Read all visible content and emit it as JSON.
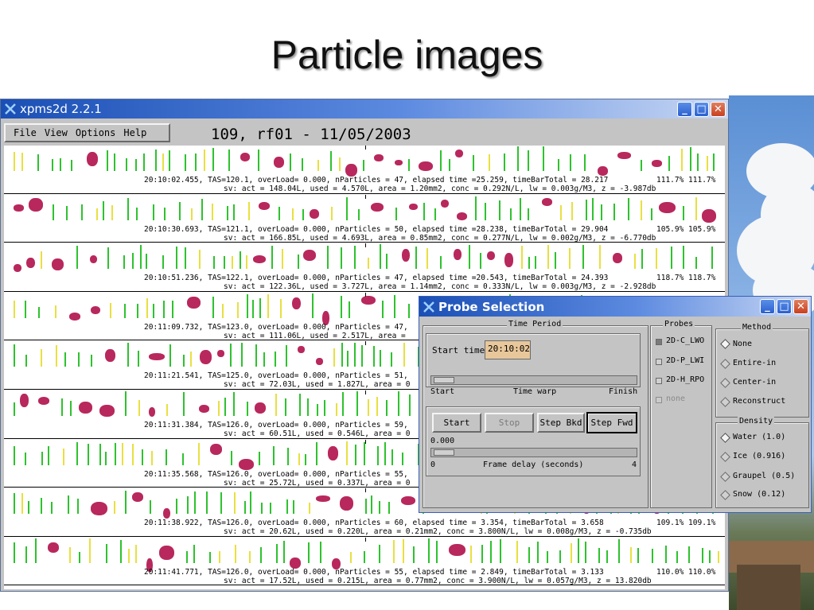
{
  "slide": {
    "title": "Particle images"
  },
  "window": {
    "title": "xpms2d 2.2.1",
    "menu": [
      "File",
      "View",
      "Options",
      "Help"
    ],
    "headline": "109, rf01 - 11/05/2003",
    "controls": {
      "minimize": "_",
      "maximize": "□",
      "close": "✕"
    }
  },
  "strips": [
    {
      "line1": "20:10:02.455, TAS=120.1, overLoad= 0.000, nParticles = 47, elapsed time =25.259, timeBarTotal = 28.217",
      "line1_right": "111.7% 111.7%",
      "line2": "sv: act = 148.04L, used = 4.570L, area = 1.20mm2, conc = 0.292N/L, lw = 0.003g/M3, z = -3.987db"
    },
    {
      "line1": "20:10:30.693, TAS=121.1, overLoad= 0.000, nParticles = 50, elapsed time =28.238, timeBarTotal = 29.904",
      "line1_right": "105.9% 105.9%",
      "line2": "sv: act = 166.85L, used = 4.693L, area = 0.85mm2, conc = 0.277N/L, lw = 0.002g/M3, z = -6.770db"
    },
    {
      "line1": "20:10:51.236, TAS=122.1, overLoad= 0.000, nParticles = 47, elapsed time =20.543, timeBarTotal = 24.393",
      "line1_right": "118.7% 118.7%",
      "line2": "sv: act = 122.36L, used = 3.727L, area = 1.14mm2, conc = 0.333N/L, lw = 0.003g/M3, z = -2.928db"
    },
    {
      "line1": "20:11:09.732, TAS=123.0, overLoad= 0.000, nParticles = 47,",
      "line1_right": "",
      "line2": "sv: act = 111.06L, used = 2.517L, area ="
    },
    {
      "line1": "20:11:21.541, TAS=125.0, overLoad= 0.000, nParticles = 51,",
      "line1_right": "",
      "line2": "sv: act = 72.03L, used = 1.827L, area = 0"
    },
    {
      "line1": "20:11:31.384, TAS=126.0, overLoad= 0.000, nParticles = 59,",
      "line1_right": "",
      "line2": "sv: act = 60.51L, used = 0.546L, area = 0"
    },
    {
      "line1": "20:11:35.568, TAS=126.0, overLoad= 0.000, nParticles = 55,",
      "line1_right": "",
      "line2": "sv: act = 25.72L, used = 0.337L, area = 0"
    },
    {
      "line1": "20:11:38.922, TAS=126.0, overLoad= 0.000, nParticles = 60, elapsed time = 3.354, timeBarTotal = 3.658",
      "line1_right": "109.1% 109.1%",
      "line2": "sv: act = 20.62L, used = 0.220L, area = 0.21mm2, conc = 3.800N/L, lw = 0.008g/M3, z = -0.735db"
    },
    {
      "line1": "20:11:41.771, TAS=126.0, overLoad= 0.000, nParticles = 55, elapsed time = 2.849, timeBarTotal = 3.133",
      "line1_right": "110.0% 110.0%",
      "line2": "sv: act = 17.52L, used = 0.215L, area = 0.77mm2, conc = 3.900N/L, lw = 0.057g/M3, z = 13.820db"
    }
  ],
  "dialog": {
    "title": "Probe Selection",
    "time_period": {
      "label": "Time Period",
      "start_time_label": "Start time",
      "start_time_value": "20:10:02",
      "slider_start": "Start",
      "slider_mid": "Time warp",
      "slider_end": "Finish"
    },
    "playback": {
      "buttons": [
        "Start",
        "Stop",
        "Step Bkd",
        "Step Fwd"
      ],
      "delay_value": "0.000",
      "delay_min": "0",
      "delay_label": "Frame delay (seconds)",
      "delay_max": "4"
    },
    "probes": {
      "label": "Probes",
      "items": [
        {
          "label": "2D-C_LWO",
          "checked": true,
          "enabled": true
        },
        {
          "label": "2D-P_LWI",
          "checked": false,
          "enabled": true
        },
        {
          "label": "2D-H_RPO",
          "checked": false,
          "enabled": true
        },
        {
          "label": "none",
          "checked": false,
          "enabled": false
        }
      ]
    },
    "method": {
      "label": "Method",
      "options": [
        "None",
        "Entire-in",
        "Center-in",
        "Reconstruct"
      ],
      "selected": "None"
    },
    "density": {
      "label": "Density",
      "options": [
        "Water (1.0)",
        "Ice (0.916)",
        "Graupel (0.5)",
        "Snow (0.12)"
      ],
      "selected": "Water (1.0)"
    }
  },
  "colors": {
    "particle_green": "#2ec22e",
    "particle_yellow": "#e8e040",
    "particle_blob": "#b8285c",
    "title_bar": "#1a4fb5"
  }
}
